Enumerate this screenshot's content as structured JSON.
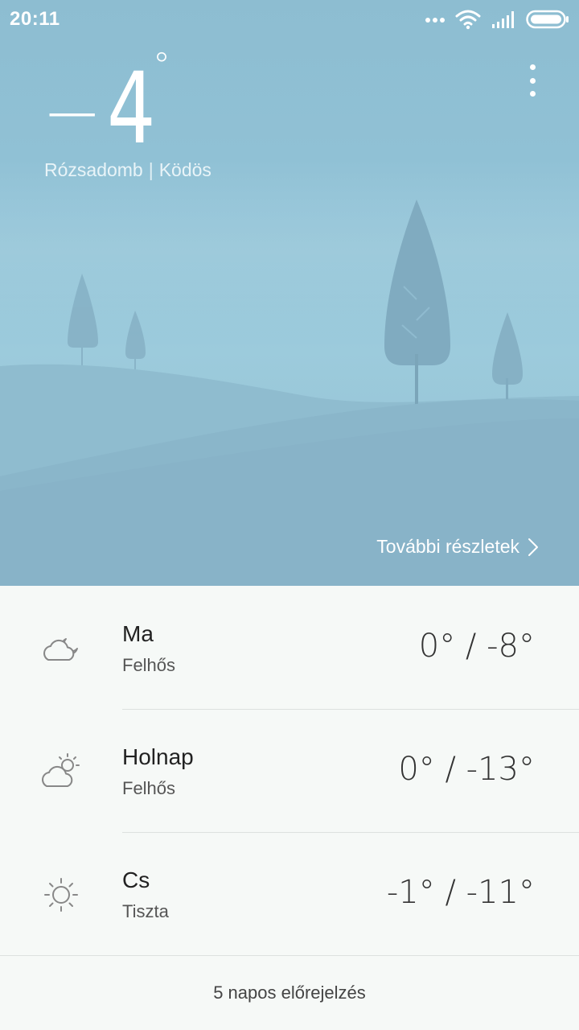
{
  "status_bar": {
    "time": "20:11",
    "icons": [
      "more-dots-icon",
      "wifi-icon",
      "signal-icon",
      "battery-icon"
    ]
  },
  "current": {
    "temperature_sign": "−",
    "temperature_value": "4",
    "temperature_unit": "°",
    "location": "Rózsadomb",
    "separator": "|",
    "condition": "Ködös"
  },
  "details_link": {
    "label": "További részletek"
  },
  "forecast": [
    {
      "day": "Ma",
      "condition": "Felhős",
      "temps": "0° / -8°",
      "icon": "cloud-moon-icon"
    },
    {
      "day": "Holnap",
      "condition": "Felhős",
      "temps": "0° / -13°",
      "icon": "cloud-sun-icon"
    },
    {
      "day": "Cs",
      "condition": "Tiszta",
      "temps": "-1° / -11°",
      "icon": "sun-icon"
    }
  ],
  "five_day_label": "5 napos előrejelzés",
  "colors": {
    "sky": "#92c3d7",
    "hill_back": "#8fbccf",
    "hill_front": "#88b3c8",
    "panel": "#f6f9f7"
  }
}
